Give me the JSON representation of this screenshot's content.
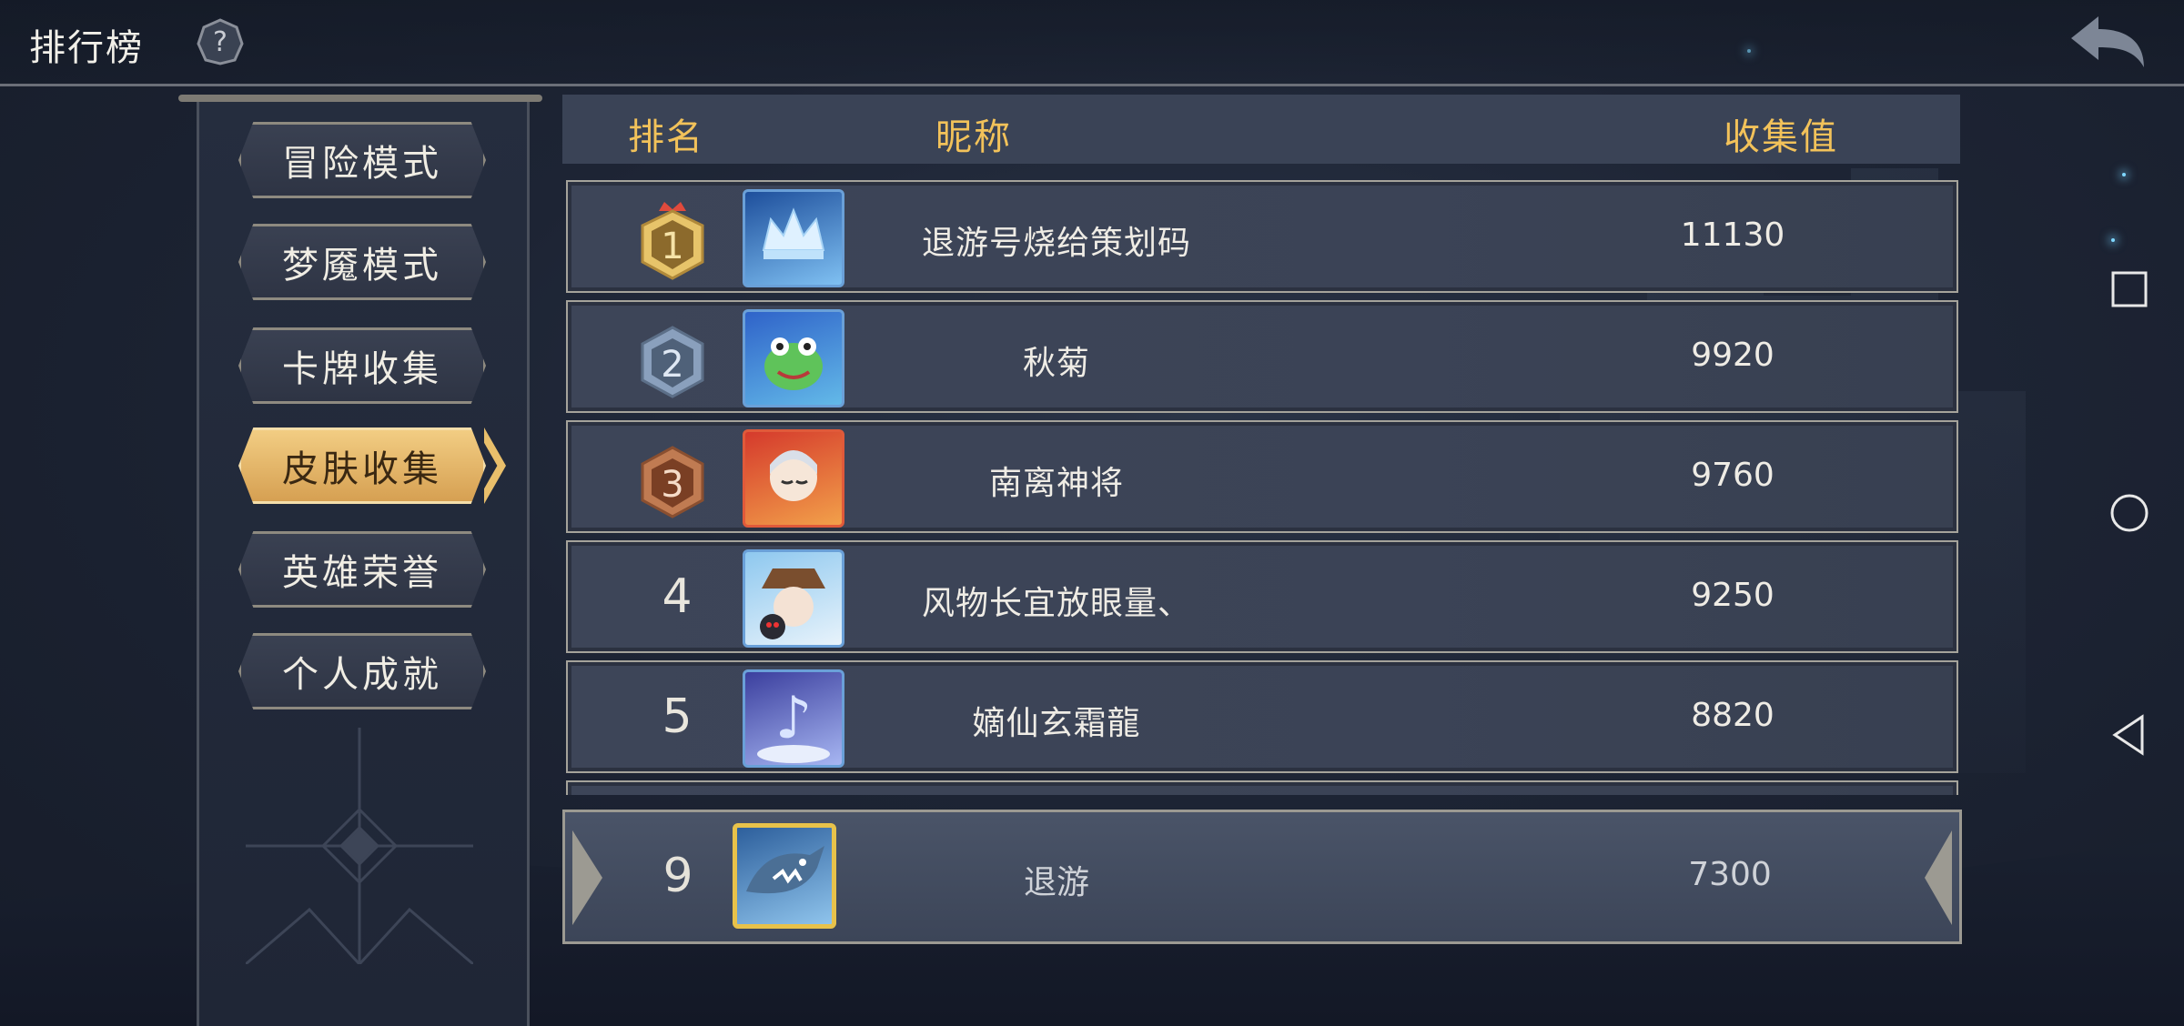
{
  "header": {
    "title": "排行榜"
  },
  "menu": {
    "items": [
      {
        "label": "冒险模式",
        "active": false
      },
      {
        "label": "梦魇模式",
        "active": false
      },
      {
        "label": "卡牌收集",
        "active": false
      },
      {
        "label": "皮肤收集",
        "active": true
      },
      {
        "label": "英雄荣誉",
        "active": false
      },
      {
        "label": "个人成就",
        "active": false
      }
    ]
  },
  "table": {
    "columns": {
      "rank": "排名",
      "nickname": "昵称",
      "value": "收集值"
    },
    "rows": [
      {
        "rank": "1",
        "nickname": "退游号烧给策划码",
        "value": "11130",
        "badge": "gold",
        "avatar": "crown-avatar"
      },
      {
        "rank": "2",
        "nickname": "秋菊",
        "value": "9920",
        "badge": "silver",
        "avatar": "frog-avatar"
      },
      {
        "rank": "3",
        "nickname": "南离神将",
        "value": "9760",
        "badge": "bronze",
        "avatar": "fire-girl-avatar"
      },
      {
        "rank": "4",
        "nickname": "风物长宜放眼量、",
        "value": "9250",
        "badge": null,
        "avatar": "witch-avatar"
      },
      {
        "rank": "5",
        "nickname": "嫡仙玄霜龍",
        "value": "8820",
        "badge": null,
        "avatar": "music-avatar"
      }
    ]
  },
  "my_rank": {
    "rank": "9",
    "nickname": "退游",
    "value": "7300",
    "avatar": "shark-avatar"
  },
  "colors": {
    "accent_gold": "#f2c25a",
    "panel": "#3b4356",
    "background": "#1d2434"
  }
}
